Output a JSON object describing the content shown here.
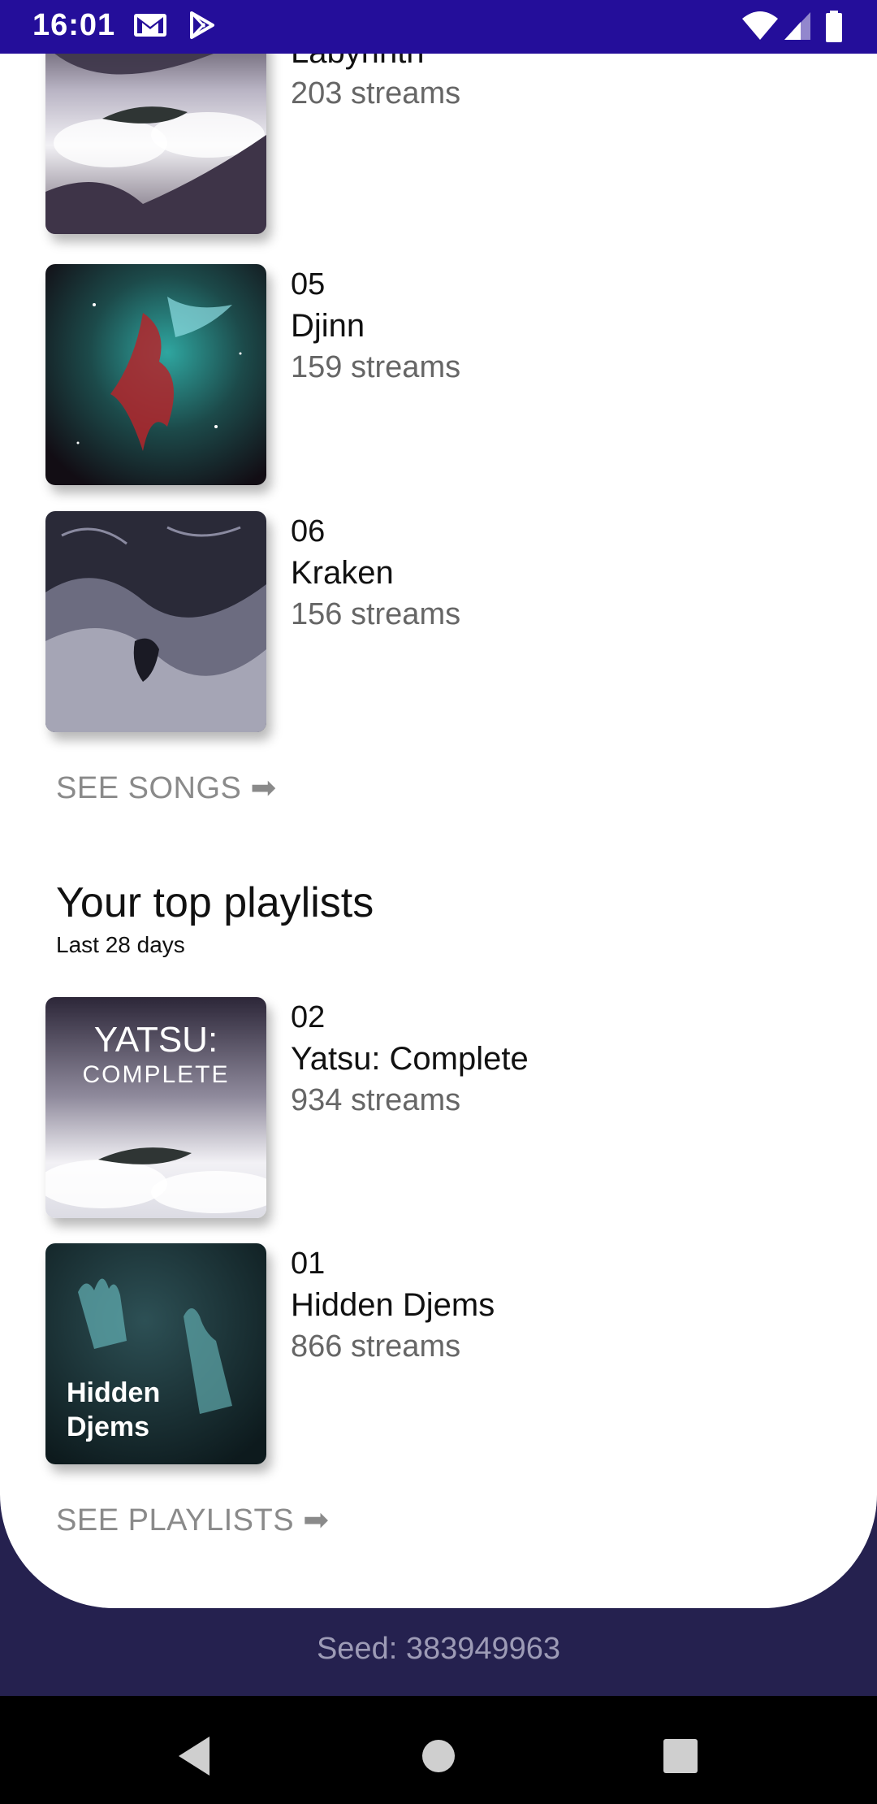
{
  "status_bar": {
    "time": "16:01",
    "icons": [
      "gmail-icon",
      "play-store-icon",
      "wifi-icon",
      "signal-icon",
      "battery-icon"
    ]
  },
  "top_songs": {
    "items": [
      {
        "rank": "",
        "title": "Labyrinth",
        "streams": "203 streams",
        "art": "whale-clouds"
      },
      {
        "rank": "05",
        "title": "Djinn",
        "streams": "159 streams",
        "art": "nebula"
      },
      {
        "rank": "06",
        "title": "Kraken",
        "streams": "156 streams",
        "art": "engraving"
      }
    ],
    "see_more": "SEE SONGS ➡"
  },
  "top_playlists": {
    "title": "Your top playlists",
    "subtitle": "Last 28 days",
    "items": [
      {
        "rank": "02",
        "title": "Yatsu: Complete",
        "streams": "934 streams",
        "art_text_1": "YATSU:",
        "art_text_2": "COMPLETE"
      },
      {
        "rank": "01",
        "title": "Hidden Djems",
        "streams": "866 streams",
        "art_text_1": "Hidden",
        "art_text_2": "Djems"
      }
    ],
    "see_more": "SEE PLAYLISTS ➡"
  },
  "seed": "Seed: 383949963",
  "colors": {
    "status_bar": "#240e9a",
    "background": "#25214f",
    "card": "#ffffff",
    "link": "#8a8a8a"
  }
}
